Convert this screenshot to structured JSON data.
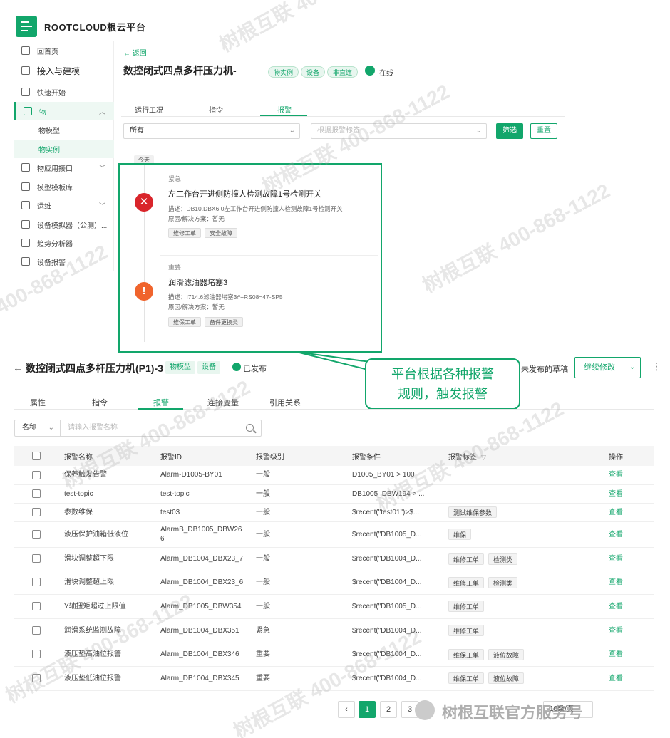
{
  "brand": {
    "name": "ROOTCLOUD根云平台"
  },
  "sidebar": {
    "items": [
      {
        "label": "回首页",
        "icon": "home-icon"
      },
      {
        "label": "接入与建模",
        "icon": "chip-icon"
      },
      {
        "label": "快速开始",
        "icon": "book-icon"
      },
      {
        "label": "物",
        "icon": "cube-icon"
      },
      {
        "label": "物模型"
      },
      {
        "label": "物实例"
      },
      {
        "label": "物应用接口",
        "icon": "api-icon"
      },
      {
        "label": "模型模板库",
        "icon": "template-icon"
      },
      {
        "label": "运维",
        "icon": "monitor-icon"
      },
      {
        "label": "设备模拟器（公测）...",
        "icon": "simulator-icon"
      },
      {
        "label": "趋势分析器",
        "icon": "trend-icon"
      },
      {
        "label": "设备报警",
        "icon": "alarm-icon"
      }
    ]
  },
  "detail": {
    "back": "← 返回",
    "title": "数控闭式四点多杆压力机-",
    "tags": [
      "物实例",
      "设备",
      "非直连"
    ],
    "status": "在线",
    "tabs": [
      "运行工况",
      "指令",
      "报警"
    ],
    "filter_level": "所有",
    "filter_level_chevron": "⌄",
    "filter_placeholder": "根据报警标签",
    "filter_button": "筛选",
    "reset_button": "重置",
    "today": "今天",
    "alarms": [
      {
        "level": "紧急",
        "title": "左工作台开进侧防撞人检测故障1号检测开关",
        "desc": "描述：DB10.DBX6.0左工作台开进侧防撞人检测故障1号检测开关",
        "reason": "原因/解决方案：暂无",
        "labels": [
          "维修工单",
          "安全故障"
        ],
        "icon_symbol": "✕",
        "color": "#d9252b"
      },
      {
        "level": "重要",
        "title": "润滑滤油器堵塞3",
        "desc": "描述：I714.6滤油器堵塞3#+RS08=47-SP5",
        "reason": "原因/解决方案：暂无",
        "labels": [
          "维保工单",
          "备件更换类"
        ],
        "icon_symbol": "!",
        "color": "#f0642d"
      }
    ]
  },
  "callout": {
    "line1": "平台根据各种报警",
    "line2": "规则，触发报警"
  },
  "model": {
    "back": "←",
    "title": "数控闭式四点多杆压力机(P1)-3",
    "tags": [
      "物模型",
      "设备"
    ],
    "published": "已发布",
    "draft": "未发布的草稿",
    "continue_button": "继续修改",
    "dropdown_chevron": "⌄",
    "more": "⋮",
    "tabs": [
      "属性",
      "指令",
      "报警",
      "连接变量",
      "引用关系"
    ],
    "search_field": "名称",
    "search_field_chevron": "⌄",
    "search_placeholder": "请输入报警名称",
    "columns": [
      "报警名称",
      "报警ID",
      "报警级别",
      "报警条件",
      "报警标签",
      "操作"
    ],
    "rows": [
      {
        "name": "保养触发告警",
        "id": "Alarm-D1005-BY01",
        "level": "一般",
        "cond": "D1005_BY01 > 100",
        "labels": [],
        "action": "查看"
      },
      {
        "name": "test-topic",
        "id": "test-topic",
        "level": "一般",
        "cond": "DB1005_DBW194 > ...",
        "labels": [],
        "action": "查看"
      },
      {
        "name": "参数维保",
        "id": "test03",
        "level": "一般",
        "cond": "$recent(\"test01\")>$...",
        "labels": [
          "测试维保参数"
        ],
        "action": "查看"
      },
      {
        "name": "液压保护油箱低液位",
        "id": "AlarmB_DB1005_DBW266",
        "level": "一般",
        "cond": "$recent(\"DB1005_D...",
        "labels": [
          "维保"
        ],
        "action": "查看"
      },
      {
        "name": "滑块调整超下限",
        "id": "Alarm_DB1004_DBX23_7",
        "level": "一般",
        "cond": "$recent(\"DB1004_D...",
        "labels": [
          "维修工单",
          "检测类"
        ],
        "action": "查看"
      },
      {
        "name": "滑块调整超上限",
        "id": "Alarm_DB1004_DBX23_6",
        "level": "一般",
        "cond": "$recent(\"DB1004_D...",
        "labels": [
          "维修工单",
          "检测类"
        ],
        "action": "查看"
      },
      {
        "name": "Y轴扭矩超过上限值",
        "id": "Alarm_DB1005_DBW354",
        "level": "一般",
        "cond": "$recent(\"DB1005_D...",
        "labels": [
          "维修工单"
        ],
        "action": "查看"
      },
      {
        "name": "润滑系统监测故障",
        "id": "Alarm_DB1004_DBX351",
        "level": "紧急",
        "cond": "$recent(\"DB1004_D...",
        "labels": [
          "维修工单"
        ],
        "action": "查看"
      },
      {
        "name": "液压垫高油位报警",
        "id": "Alarm_DB1004_DBX346",
        "level": "重要",
        "cond": "$recent(\"DB1004_D...",
        "labels": [
          "维保工单",
          "液位故障"
        ],
        "action": "查看"
      },
      {
        "name": "液压垫低油位报警",
        "id": "Alarm_DB1004_DBX345",
        "level": "重要",
        "cond": "$recent(\"DB1004_D...",
        "labels": [
          "维保工单",
          "液位故障"
        ],
        "action": "查看"
      }
    ],
    "pagination": {
      "prev": "‹",
      "pages": [
        "1",
        "2",
        "3"
      ],
      "current": "1",
      "size": "10条/页"
    }
  },
  "watermark": {
    "text": "树根互联 400-868-1122",
    "footer": "树根互联官方服务号"
  },
  "colors": {
    "accent": "#12a66b",
    "urgent": "#d9252b",
    "important": "#f0642d"
  }
}
